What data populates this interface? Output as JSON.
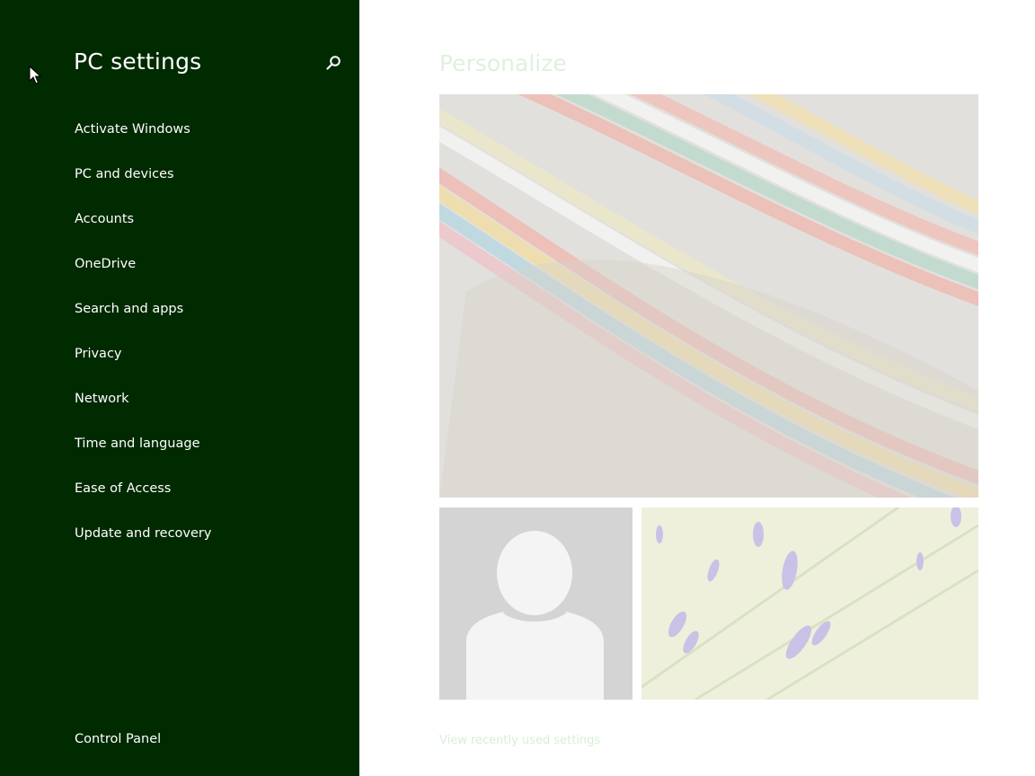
{
  "nav": {
    "title": "PC settings",
    "search_icon": "search-icon",
    "items": [
      {
        "label": "Activate Windows"
      },
      {
        "label": "PC and devices"
      },
      {
        "label": "Accounts"
      },
      {
        "label": "OneDrive"
      },
      {
        "label": "Search and apps"
      },
      {
        "label": "Privacy"
      },
      {
        "label": "Network"
      },
      {
        "label": "Time and language"
      },
      {
        "label": "Ease of Access"
      },
      {
        "label": "Update and recovery"
      }
    ],
    "footer_link": "Control Panel"
  },
  "main": {
    "title": "Personalize",
    "tiles": {
      "lock_screen": {
        "icon": "lock-screen-image"
      },
      "account_picture": {
        "icon": "user-avatar-icon"
      },
      "start_screen": {
        "icon": "start-screen-image"
      }
    },
    "recent_link": "View recently used settings"
  },
  "colors": {
    "nav_bg": "#002a00",
    "nav_text": "#ffffff",
    "content_bg": "#ffffff",
    "accent_faded": "#dff0df"
  }
}
